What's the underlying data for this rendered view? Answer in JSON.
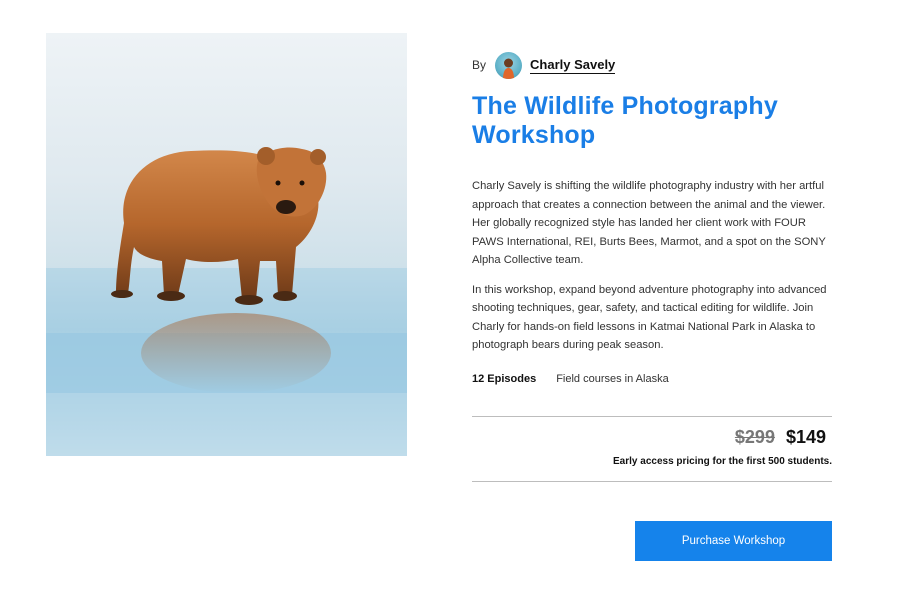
{
  "author": {
    "by_label": "By",
    "name": "Charly Savely"
  },
  "workshop": {
    "title": "The Wildlife Photography Workshop",
    "description_1": "Charly Savely is shifting the wildlife photography industry with her artful approach that creates a connection between the animal and the viewer. Her globally recognized style has landed her client work with FOUR PAWS International, REI, Burts Bees, Marmot, and a spot on the SONY Alpha Collective team.",
    "description_2": "In this workshop, expand beyond adventure photography into advanced shooting techniques, gear, safety, and tactical editing for wildlife. Join Charly for hands-on field lessons in Katmai National Park in Alaska to photograph bears during peak season.",
    "episodes": "12 Episodes",
    "field_courses": "Field courses in Alaska"
  },
  "pricing": {
    "old_price": "$299",
    "new_price": "$149",
    "note": "Early access pricing for the first 500 students."
  },
  "actions": {
    "purchase_label": "Purchase Workshop"
  },
  "colors": {
    "accent": "#1a7ee6",
    "button": "#1583eb"
  }
}
